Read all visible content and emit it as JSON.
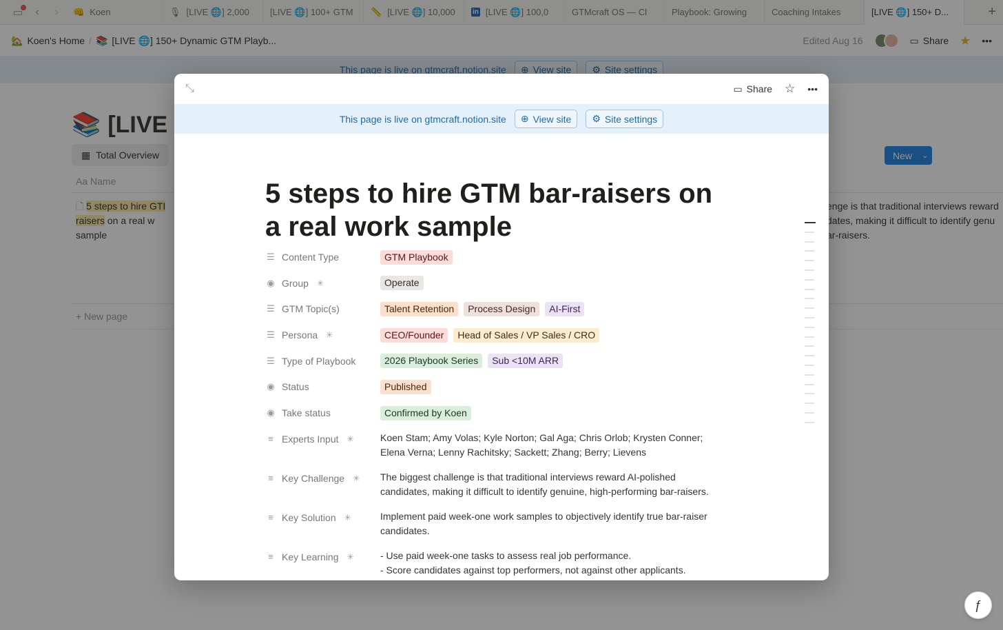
{
  "tabs": [
    {
      "icon": "👊",
      "label": "Koen"
    },
    {
      "icon": "🎙",
      "label": "[LIVE 🌐] 2,000"
    },
    {
      "icon": "",
      "label": "[LIVE 🌐] 100+ GTM"
    },
    {
      "icon": "📏",
      "label": "[LIVE 🌐] 10,000"
    },
    {
      "icon": "in",
      "label": "[LIVE 🌐] 100,0"
    },
    {
      "icon": "",
      "label": "GTMcraft OS — Cl"
    },
    {
      "icon": "",
      "label": "Playbook: Growing"
    },
    {
      "icon": "",
      "label": "Coaching Intakes"
    },
    {
      "icon": "",
      "label": "[LIVE 🌐] 150+ D..."
    }
  ],
  "breadcrumb": {
    "home": "Koen's Home",
    "page": "[LIVE 🌐] 150+ Dynamic GTM Playb...",
    "edited": "Edited Aug 16",
    "share": "Share"
  },
  "live_banner": {
    "text": "This page is live on gtmcraft.notion.site",
    "view_site": "View site",
    "site_settings": "Site settings"
  },
  "background": {
    "title": "[LIVE 🌐",
    "view_tab": "Total Overview",
    "name_col": "Name",
    "row_title_hl1": "5 steps to hire GTI",
    "row_title_hl2": "raisers",
    "row_title_rest": " on a real w",
    "row_title_end": "sample",
    "new_page": "New page",
    "new_button": "New",
    "right_text_1": "enge is that traditional interviews reward",
    "right_text_2": "dates, making it difficult to identify genu",
    "right_text_3": "ar-raisers."
  },
  "modal": {
    "share": "Share",
    "title": "5 steps to hire GTM bar-raisers on a real work sample",
    "properties": {
      "content_type": {
        "label": "Content Type",
        "tags": [
          "GTM Playbook"
        ]
      },
      "group": {
        "label": "Group",
        "tags": [
          "Operate"
        ]
      },
      "gtm_topics": {
        "label": "GTM Topic(s)",
        "tags": [
          "Talent Retention",
          "Process Design",
          "AI-First"
        ]
      },
      "persona": {
        "label": "Persona",
        "tags": [
          "CEO/Founder",
          "Head of Sales / VP Sales / CRO"
        ]
      },
      "type_of_playbook": {
        "label": "Type of Playbook",
        "tags": [
          "2026 Playbook Series",
          "Sub <10M ARR"
        ]
      },
      "status": {
        "label": "Status",
        "tags": [
          "Published"
        ]
      },
      "take_status": {
        "label": "Take status",
        "tags": [
          "Confirmed by Koen"
        ]
      },
      "experts_input": {
        "label": "Experts Input",
        "text": "Koen Stam; Amy Volas; Kyle Norton; Gal Aga; Chris Orlob; Krysten Conner;\nElena Verna; Lenny Rachitsky; Sackett; Zhang; Berry; Lievens"
      },
      "key_challenge": {
        "label": "Key Challenge",
        "text": "The biggest challenge is that traditional interviews reward AI-polished\ncandidates, making it difficult to identify genuine, high-performing bar-raisers."
      },
      "key_solution": {
        "label": "Key Solution",
        "text": "Implement paid week-one work samples to objectively identify true bar-raiser\ncandidates."
      },
      "key_learning": {
        "label": "Key Learning",
        "text": "- Use paid week-one tasks to assess real job performance.\n- Score candidates against top performers, not against other applicants."
      }
    }
  },
  "colors": {
    "accent": "#2383e2",
    "live_banner_bg": "#e5f1fa",
    "live_text": "#1f6aa5"
  }
}
